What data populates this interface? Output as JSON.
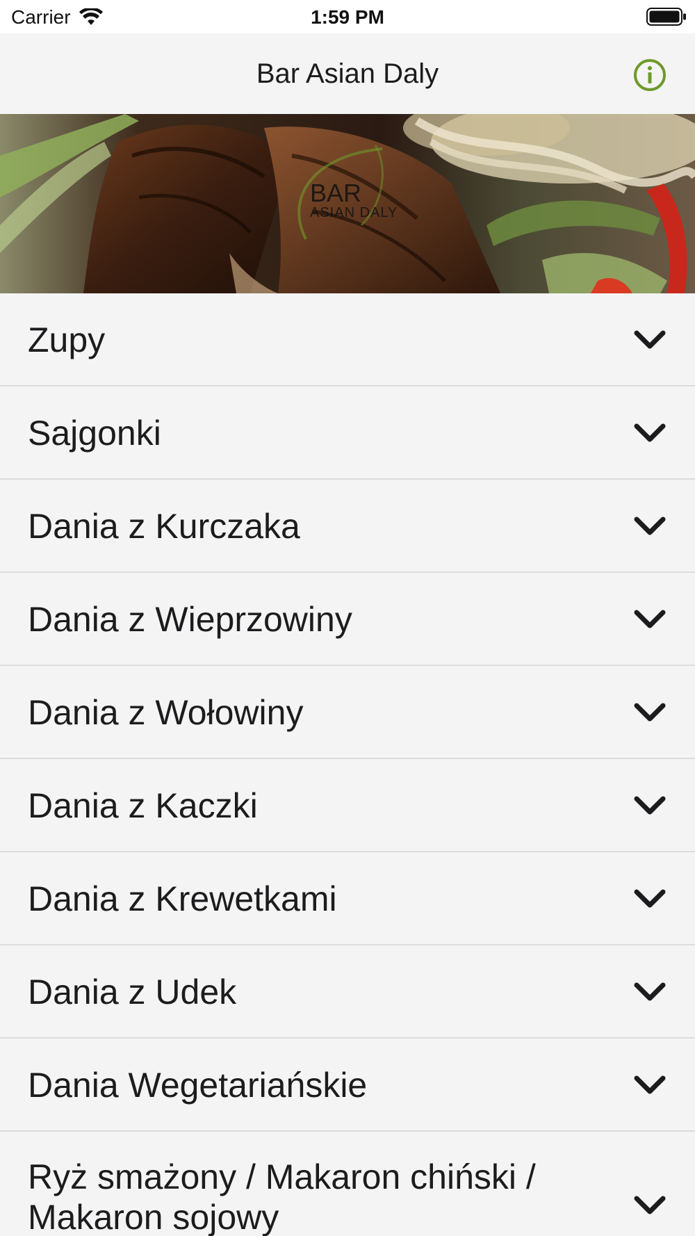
{
  "status_bar": {
    "carrier": "Carrier",
    "time": "1:59 PM"
  },
  "nav": {
    "title": "Bar Asian Daly",
    "info_icon": "info-icon",
    "accent_color": "#6f9a2a"
  },
  "banner": {
    "logo_line1": "BAR",
    "logo_line2": "ASIAN DALY"
  },
  "menu": {
    "items": [
      {
        "label": "Zupy"
      },
      {
        "label": "Sajgonki"
      },
      {
        "label": "Dania z Kurczaka"
      },
      {
        "label": "Dania z Wieprzowiny"
      },
      {
        "label": "Dania z Wołowiny"
      },
      {
        "label": "Dania z Kaczki"
      },
      {
        "label": "Dania z Krewetkami"
      },
      {
        "label": "Dania z Udek"
      },
      {
        "label": "Dania Wegetariańskie"
      },
      {
        "label": "Ryż smażony / Makaron chiński / Makaron sojowy"
      }
    ],
    "expand_icon": "chevron-down-icon"
  }
}
